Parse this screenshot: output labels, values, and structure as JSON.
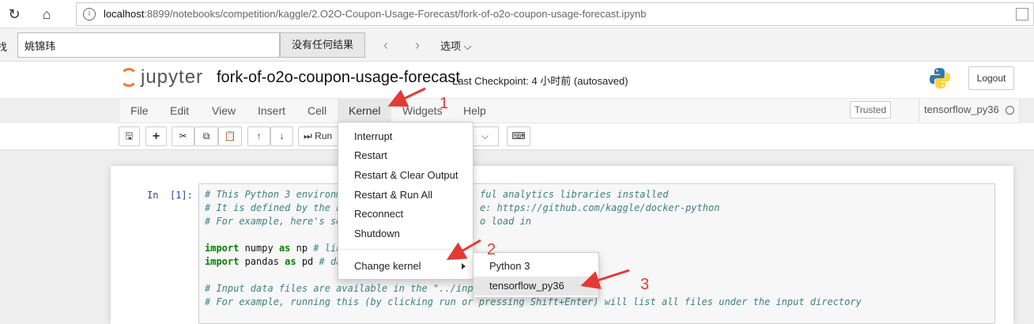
{
  "browser": {
    "url_host": "localhost",
    "url_rest": ":8899/notebooks/competition/kaggle/2.O2O-Coupon-Usage-Forecast/fork-of-o2o-coupon-usage-forecast.ipynb",
    "icons": [
      "refresh-icon",
      "home-icon",
      "info-icon",
      "reader-view-icon"
    ]
  },
  "findbar": {
    "label": "找",
    "query": "姚锦玮",
    "result": "没有任何结果",
    "options": "选项"
  },
  "jupyter": {
    "logo_text": "jupyter",
    "notebook_name": "fork-of-o2o-coupon-usage-forecast",
    "checkpoint": "Last Checkpoint: 4 小时前   (autosaved)",
    "logout": "Logout",
    "trusted": "Trusted",
    "kernel_name": "tensorflow_py36"
  },
  "menu": {
    "file": "File",
    "edit": "Edit",
    "view": "View",
    "insert": "Insert",
    "cell": "Cell",
    "kernel": "Kernel",
    "widgets": "Widgets",
    "help": "Help"
  },
  "toolbar": {
    "run": "Run",
    "icons": [
      "save-icon",
      "plus-icon",
      "scissors-icon",
      "copy-icon",
      "paste-icon",
      "arrow-up-icon",
      "arrow-down-icon",
      "keyboard-icon"
    ]
  },
  "kernel_menu": {
    "items": [
      "Interrupt",
      "Restart",
      "Restart & Clear Output",
      "Restart & Run All",
      "Reconnect",
      "Shutdown"
    ],
    "change_kernel": "Change kernel",
    "submenu": [
      "Python 3",
      "tensorflow_py36"
    ]
  },
  "cell": {
    "prompt": "In  [1]:",
    "lines": {
      "l1": "# This Python 3 environm",
      "l1b": "ful analytics libraries installed",
      "l2": "# It is defined by the k",
      "l2b": "e: https://github.com/kaggle/docker-python",
      "l3": "# For example, here's se",
      "l3b": "o load in",
      "l5_kw1": "import",
      "l5_a": " numpy ",
      "l5_kw2": "as",
      "l5_b": " np ",
      "l5_c": "# lin",
      "l6_kw1": "import",
      "l6_a": " pandas ",
      "l6_kw2": "as",
      "l6_b": " pd ",
      "l6_c": "# da",
      "l8": "# Input data files are available in the \"../input",
      "l9": "# For example, running this (by clicking run or pressing Shift+Enter) will list all files under the input directory"
    }
  },
  "annotations": [
    "1",
    "2",
    "3"
  ],
  "colors": {
    "annotation": "#e53935",
    "jupyter_orange": "#f37726",
    "prompt_blue": "#303f9f"
  }
}
